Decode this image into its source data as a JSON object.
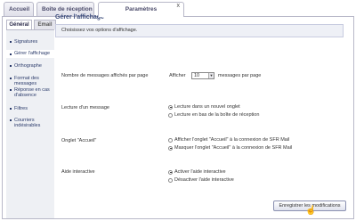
{
  "top_tabs": [
    {
      "label": "Accueil"
    },
    {
      "label": "Boîte de réception"
    },
    {
      "label": "Paramètres",
      "close": "x"
    }
  ],
  "sub_tabs": [
    {
      "label": "Général"
    },
    {
      "label": "Email"
    }
  ],
  "sidebar": {
    "items": [
      {
        "label": "Signatures"
      },
      {
        "label": "Gérer l'affichage"
      },
      {
        "label": "Orthographe"
      },
      {
        "label": "Format des messages"
      },
      {
        "label": "Réponse en cas d'absence"
      },
      {
        "label": "Filtres"
      },
      {
        "label": "Courriers indésirables"
      }
    ]
  },
  "main": {
    "title": "Gérer l'affichage",
    "intro": "Choisissez vos options d'affichage.",
    "messages_count": {
      "label": "Nombre de messages affichés par page",
      "prefix": "Afficher",
      "value": "10",
      "suffix": "messages par page"
    },
    "reading": {
      "label": "Lecture d'un message",
      "options": [
        "Lecture dans un nouvel onglet",
        "Lecture en bas de la boîte de réception"
      ]
    },
    "home_tab": {
      "label": "Onglet \"Accueil\"",
      "options": [
        "Afficher l'onglet \"Accueil\" à la connexion de SFR Mail",
        "Masquer l'onglet \"Accueil\" à la connexion de SFR Mail"
      ]
    },
    "help": {
      "label": "Aide interactive",
      "options": [
        "Activer l'aide interactive",
        "Désactiver l'aide interactive"
      ]
    },
    "save_label": "Enregistrer les modifications"
  }
}
